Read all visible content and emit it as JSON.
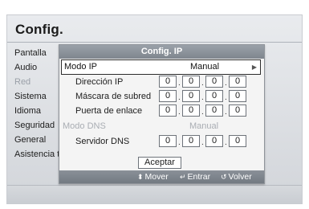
{
  "page_title": "Config.",
  "menu": [
    {
      "label": "Pantalla"
    },
    {
      "label": "Audio"
    },
    {
      "label": "Red",
      "active": true
    },
    {
      "label": "Sistema"
    },
    {
      "label": "Idioma"
    },
    {
      "label": "Seguridad"
    },
    {
      "label": "General"
    },
    {
      "label": "Asistencia té"
    }
  ],
  "dialog": {
    "title": "Config. IP",
    "ip_mode": {
      "label": "Modo IP",
      "value": "Manual"
    },
    "ip_address": {
      "label": "Dirección IP",
      "octets": [
        "0",
        "0",
        "0",
        "0"
      ]
    },
    "subnet_mask": {
      "label": "Máscara de subred",
      "octets": [
        "0",
        "0",
        "0",
        "0"
      ]
    },
    "gateway": {
      "label": "Puerta de enlace",
      "octets": [
        "0",
        "0",
        "0",
        "0"
      ]
    },
    "dns_mode": {
      "label": "Modo DNS",
      "value": "Manual"
    },
    "dns_server": {
      "label": "Servidor DNS",
      "octets": [
        "0",
        "0",
        "0",
        "0"
      ]
    },
    "accept_label": "Aceptar",
    "footer": {
      "move_label": "Mover",
      "enter_label": "Entrar",
      "back_label": "Volver"
    }
  },
  "icons": {
    "move": "up-down-arrows-icon",
    "enter": "enter-icon",
    "back": "return-icon",
    "submenu_arrow": "chevron-right-icon"
  },
  "colors": {
    "header_bar": "#8a9098",
    "disabled_text": "#a9adb3"
  }
}
